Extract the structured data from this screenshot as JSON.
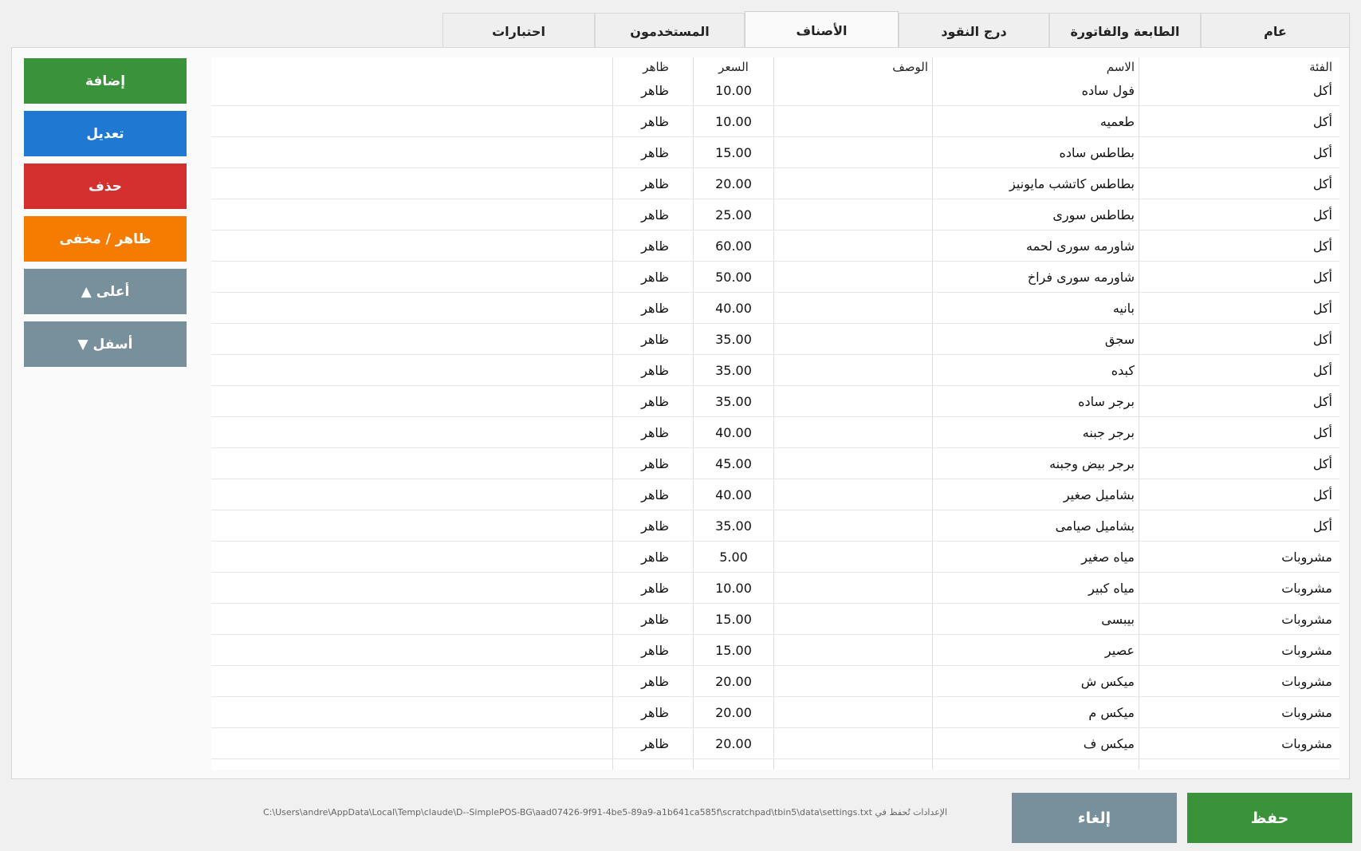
{
  "tabs": [
    "عام",
    "الطابعة والفاتورة",
    "درج النقود",
    "الأصناف",
    "المستخدمون",
    "احتبارات"
  ],
  "active_tab": "الأصناف",
  "sidebar": {
    "add": "إضافة",
    "edit": "تعديل",
    "delete": "حذف",
    "toggle_visibility": "ظاهر / مخفى",
    "move_up": "▲ أعلى",
    "move_down": "▼ أسفل"
  },
  "colors": {
    "green": "#3a923a",
    "blue": "#1f78d1",
    "red": "#d32f2f",
    "orange": "#f57c00",
    "gray": "#78909c"
  },
  "table": {
    "headers": {
      "category": "الفئة",
      "name": "الاسم",
      "description": "الوصف",
      "price": "السعر",
      "visibility": "ظاهر"
    },
    "rows": [
      {
        "category": "أكل",
        "name": "فول ساده",
        "description": "",
        "price": "10.00",
        "visibility": "ظاهر"
      },
      {
        "category": "أكل",
        "name": "طعميه",
        "description": "",
        "price": "10.00",
        "visibility": "ظاهر"
      },
      {
        "category": "أكل",
        "name": "بطاطس ساده",
        "description": "",
        "price": "15.00",
        "visibility": "ظاهر"
      },
      {
        "category": "أكل",
        "name": "بطاطس كاتشب مايونيز",
        "description": "",
        "price": "20.00",
        "visibility": "ظاهر"
      },
      {
        "category": "أكل",
        "name": "بطاطس سورى",
        "description": "",
        "price": "25.00",
        "visibility": "ظاهر"
      },
      {
        "category": "أكل",
        "name": "شاورمه سورى لحمه",
        "description": "",
        "price": "60.00",
        "visibility": "ظاهر"
      },
      {
        "category": "أكل",
        "name": "شاورمه سورى فراخ",
        "description": "",
        "price": "50.00",
        "visibility": "ظاهر"
      },
      {
        "category": "أكل",
        "name": "بانيه",
        "description": "",
        "price": "40.00",
        "visibility": "ظاهر"
      },
      {
        "category": "أكل",
        "name": "سجق",
        "description": "",
        "price": "35.00",
        "visibility": "ظاهر"
      },
      {
        "category": "أكل",
        "name": "كبده",
        "description": "",
        "price": "35.00",
        "visibility": "ظاهر"
      },
      {
        "category": "أكل",
        "name": "برجر ساده",
        "description": "",
        "price": "35.00",
        "visibility": "ظاهر"
      },
      {
        "category": "أكل",
        "name": "برجر جبنه",
        "description": "",
        "price": "40.00",
        "visibility": "ظاهر"
      },
      {
        "category": "أكل",
        "name": "برجر بيض وجبنه",
        "description": "",
        "price": "45.00",
        "visibility": "ظاهر"
      },
      {
        "category": "أكل",
        "name": "بشاميل صغير",
        "description": "",
        "price": "40.00",
        "visibility": "ظاهر"
      },
      {
        "category": "أكل",
        "name": "بشاميل صيامى",
        "description": "",
        "price": "35.00",
        "visibility": "ظاهر"
      },
      {
        "category": "مشروبات",
        "name": "مياه صغير",
        "description": "",
        "price": "5.00",
        "visibility": "ظاهر"
      },
      {
        "category": "مشروبات",
        "name": "مياه كبير",
        "description": "",
        "price": "10.00",
        "visibility": "ظاهر"
      },
      {
        "category": "مشروبات",
        "name": "بيبسى",
        "description": "",
        "price": "15.00",
        "visibility": "ظاهر"
      },
      {
        "category": "مشروبات",
        "name": "عصير",
        "description": "",
        "price": "15.00",
        "visibility": "ظاهر"
      },
      {
        "category": "مشروبات",
        "name": "ميكس ش",
        "description": "",
        "price": "20.00",
        "visibility": "ظاهر"
      },
      {
        "category": "مشروبات",
        "name": "ميكس م",
        "description": "",
        "price": "20.00",
        "visibility": "ظاهر"
      },
      {
        "category": "مشروبات",
        "name": "ميكس ف",
        "description": "",
        "price": "20.00",
        "visibility": "ظاهر"
      }
    ]
  },
  "footer": {
    "path_text": "C:\\Users\\andre\\AppData\\Local\\Temp\\claude\\D--SimplePOS-BG\\aad07426-9f91-4be5-89a9-a1b641ca585f\\scratchpad\\tbin5\\data\\settings.txt الإعدادات تُحفظ في",
    "cancel": "إلغاء",
    "save": "حفظ"
  }
}
